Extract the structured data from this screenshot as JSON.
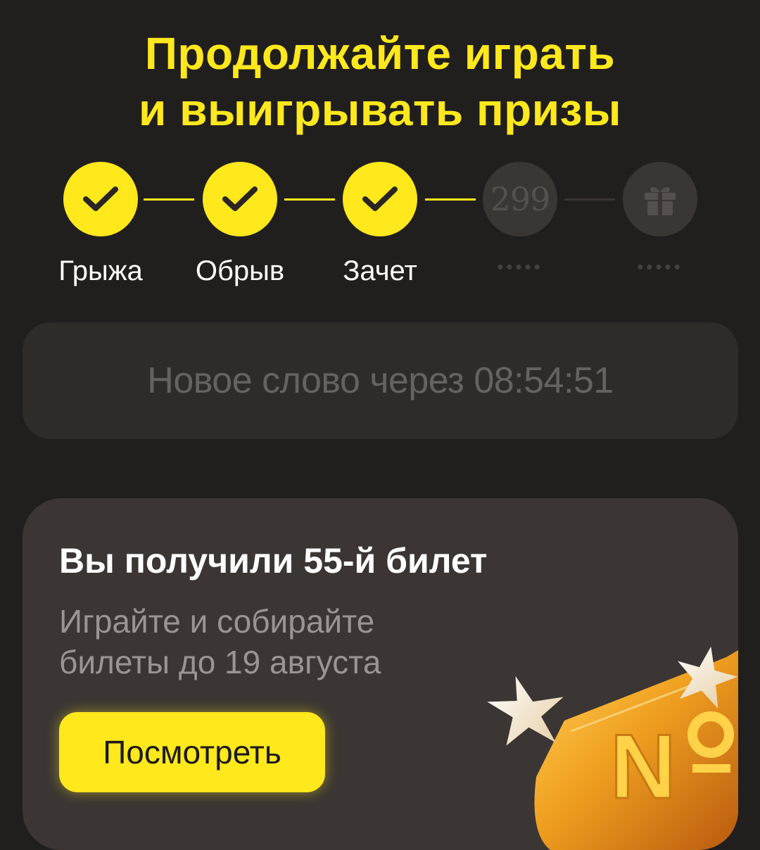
{
  "headline": {
    "line1": "Продолжайте играть",
    "line2": "и выигрывать призы"
  },
  "steps": [
    {
      "label": "Грыжа",
      "status": "done",
      "icon": "check-icon"
    },
    {
      "label": "Обрыв",
      "status": "done",
      "icon": "check-icon"
    },
    {
      "label": "Зачет",
      "status": "done",
      "icon": "check-icon"
    },
    {
      "value": "299",
      "masked_label": "•••••",
      "status": "pending"
    },
    {
      "masked_label": "•••••",
      "status": "pending",
      "icon": "gift-icon"
    }
  ],
  "timer": {
    "text": "Новое слово через 08:54:51"
  },
  "card": {
    "title": "Вы получили 55-й билет",
    "subtitle": "Играйте и собирайте билеты до 19 августа",
    "button_label": "Посмотреть",
    "illustration": "golden-ticket-icon"
  },
  "colors": {
    "accent": "#ffe81c",
    "background": "#211f1e",
    "card": "#3b3633",
    "pending_circle": "#3a3634"
  }
}
